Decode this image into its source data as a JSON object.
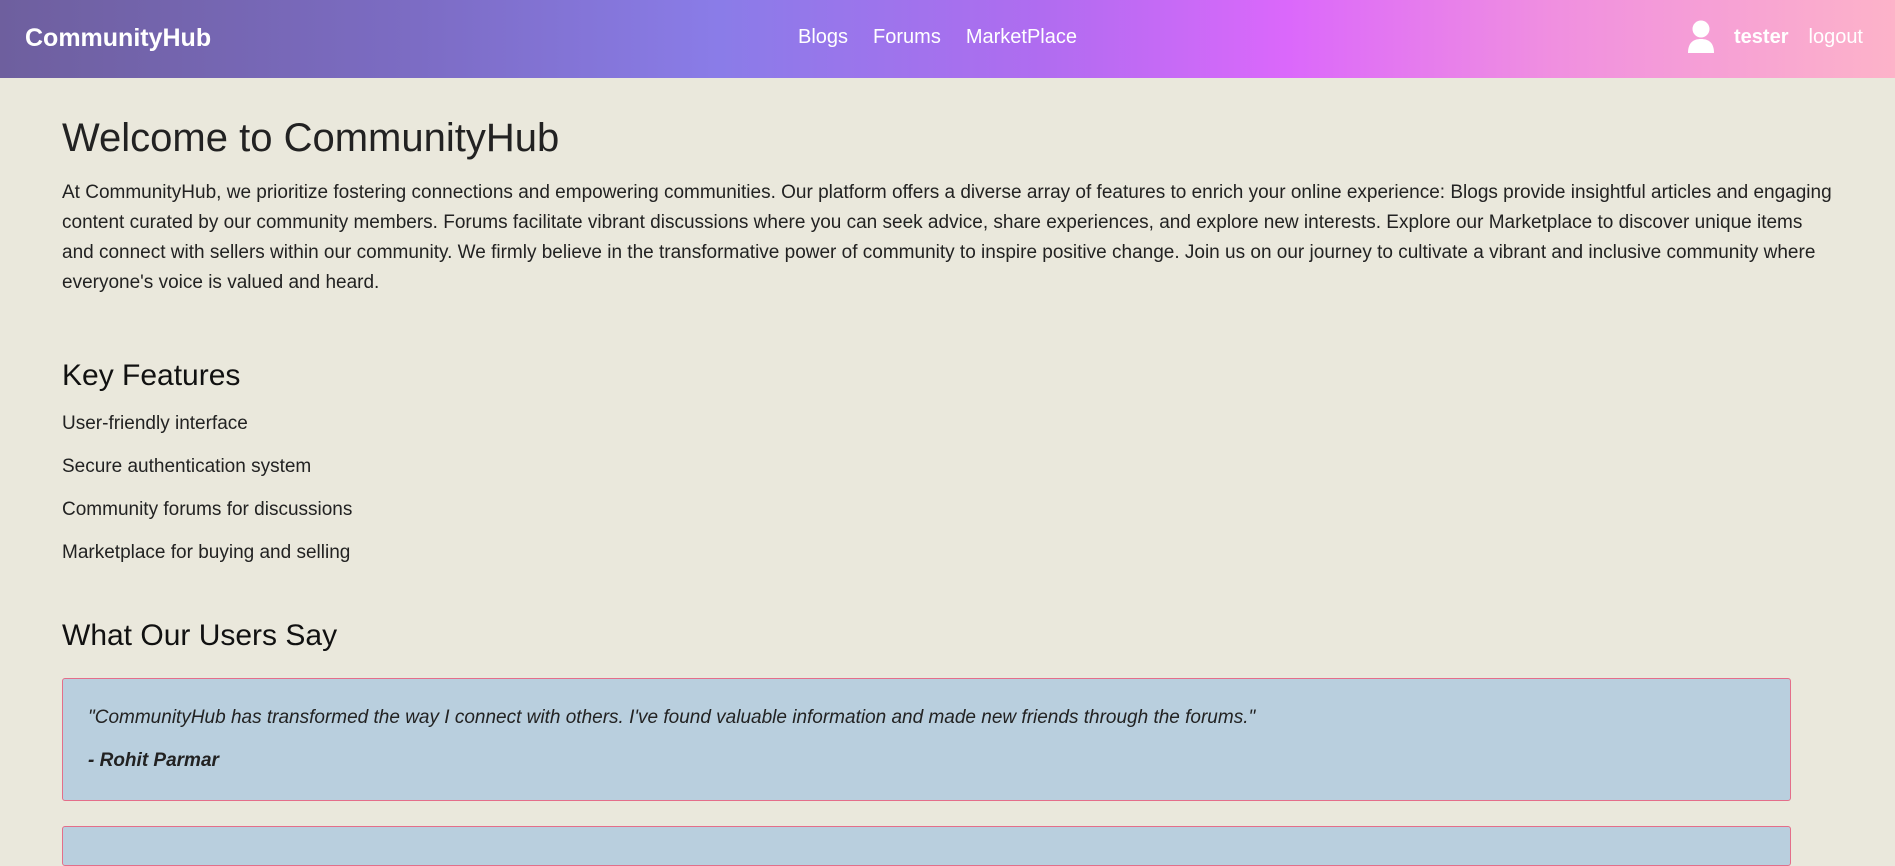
{
  "navbar": {
    "brand": "CommunityHub",
    "links": [
      "Blogs",
      "Forums",
      "MarketPlace"
    ],
    "username": "tester",
    "logout_label": "logout",
    "user_icon": "user-icon"
  },
  "main": {
    "title": "Welcome to CommunityHub",
    "intro": "At CommunityHub, we prioritize fostering connections and empowering communities. Our platform offers a diverse array of features to enrich your online experience: Blogs provide insightful articles and engaging content curated by our community members. Forums facilitate vibrant discussions where you can seek advice, share experiences, and explore new interests. Explore our Marketplace to discover unique items and connect with sellers within our community. We firmly believe in the transformative power of community to inspire positive change. Join us on our journey to cultivate a vibrant and inclusive community where everyone's voice is valued and heard.",
    "features_title": "Key Features",
    "features": [
      "User-friendly interface",
      "Secure authentication system",
      "Community forums for discussions",
      "Marketplace for buying and selling"
    ],
    "testimonials_title": "What Our Users Say",
    "testimonials": [
      {
        "quote": "\"CommunityHub has transformed the way I connect with others. I've found valuable information and made new friends through the forums.\"",
        "author": "- Rohit Parmar"
      }
    ]
  },
  "colors": {
    "background": "#eae8dc",
    "testimonial_bg": "#b9cfde",
    "testimonial_border": "#e46e8a",
    "nav_gradient_start": "#6e5f9e",
    "nav_gradient_mid": "#db68fb",
    "nav_gradient_end": "#fdb3c9"
  }
}
